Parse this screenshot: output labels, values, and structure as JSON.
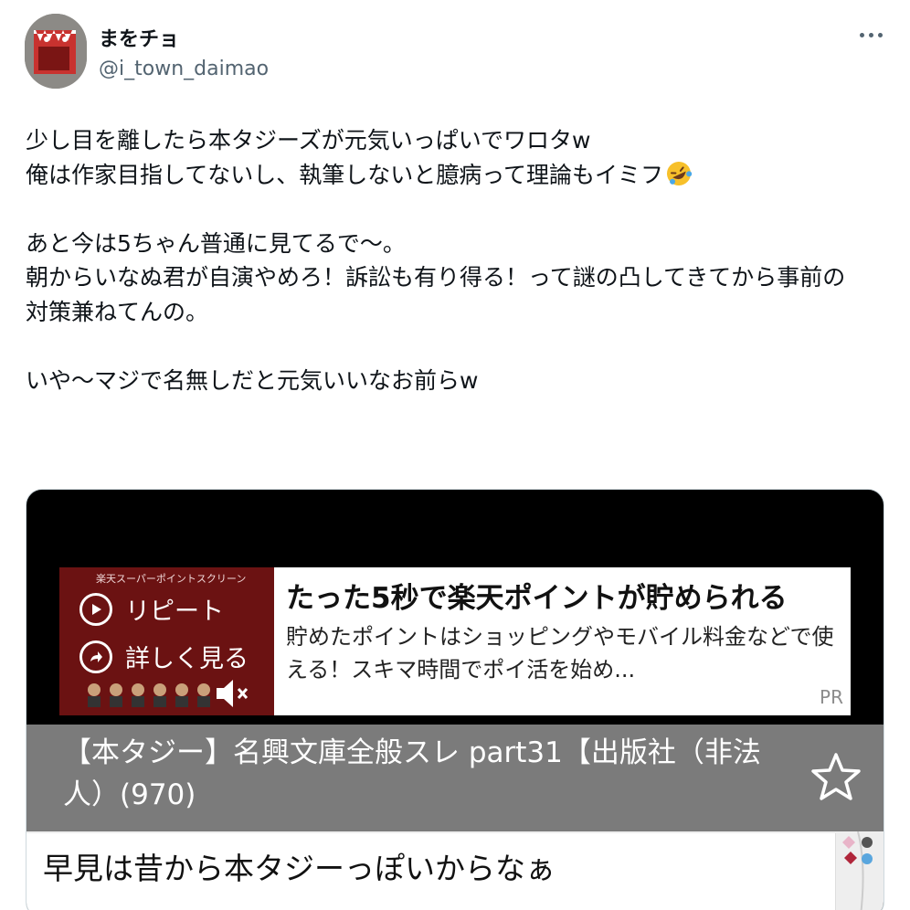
{
  "user": {
    "display_name": "まをチョ",
    "handle": "@i_town_daimao"
  },
  "tweet": {
    "lines": [
      "少し目を離したら本タジーズが元気いっぱいでワロタw",
      "俺は作家目指してないし、執筆しないと臆病って理論もイミフ",
      "",
      "あと今は5ちゃん普通に見てるで〜。",
      "朝からいなぬ君が自演やめろ！訴訟も有り得る！って謎の凸してきてから事前の",
      "対策兼ねてんの。",
      "",
      "いや〜マジで名無しだと元気いいなお前らw"
    ],
    "emoji": "rolling-on-floor-laughing-emoji"
  },
  "media": {
    "ad": {
      "brand_text": "楽天スーパーポイントスクリーン",
      "repeat_label": "リピート",
      "details_label": "詳しく見る",
      "title": "たった5秒で楽天ポイントが貯められる",
      "description": "貯めたポイントはショッピングやモバイル料金などで使える！スキマ時間でポイ活を始め...",
      "pr_label": "PR"
    },
    "thread": {
      "title": "【本タジー】名興文庫全般スレ part31【出版社（非法人）(970)"
    },
    "post": {
      "text": "早見は昔から本タジーっぽいからなぁ"
    }
  },
  "colors": {
    "text": "#0f1419",
    "secondary": "#536471",
    "ad_image_bg": "#6b1212",
    "thread_bar": "#7b7b7b"
  }
}
